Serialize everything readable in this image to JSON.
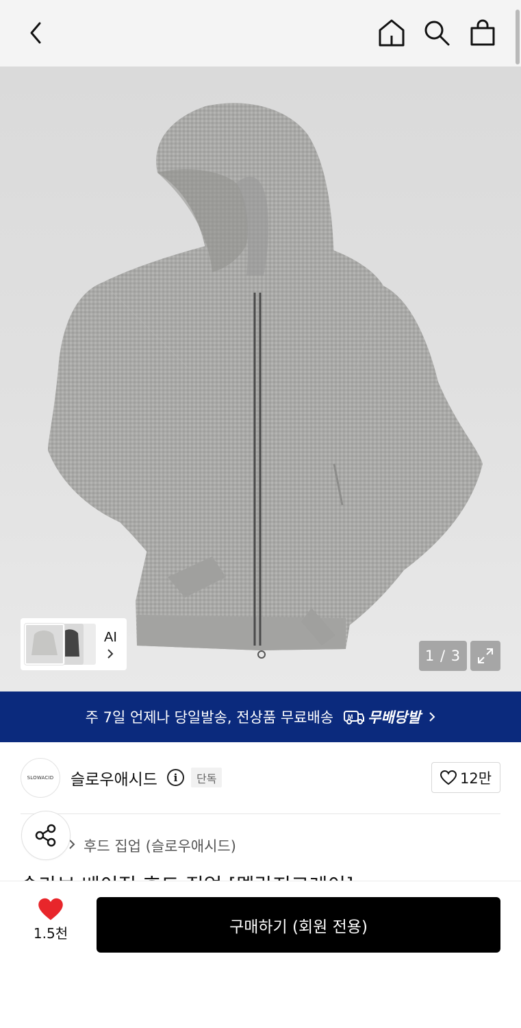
{
  "header": {
    "icons": [
      "chevron-left-icon",
      "home-icon",
      "search-icon",
      "shopping-bag-icon"
    ]
  },
  "gallery": {
    "ai_label": "AI",
    "page_indicator": "1 / 3",
    "expand_icon": "expand-icon"
  },
  "banner": {
    "text": "주 7일 언제나 당일발송, 전상품 무료배송",
    "service_name": "무배당발",
    "background": "#0b2a7d"
  },
  "store": {
    "logo_text": "SLOWACID",
    "name": "슬로우애시드",
    "badge": "단독",
    "likes": "12만"
  },
  "product": {
    "category": "후드 집업 (슬로우애시드)",
    "title": "슬라브 베이직 후드 집업 [멜란지그레이]"
  },
  "bottom_bar": {
    "wish_count": "1.5천",
    "wish_color": "#e8262b",
    "buy_label": "구매하기 (회원 전용)"
  }
}
